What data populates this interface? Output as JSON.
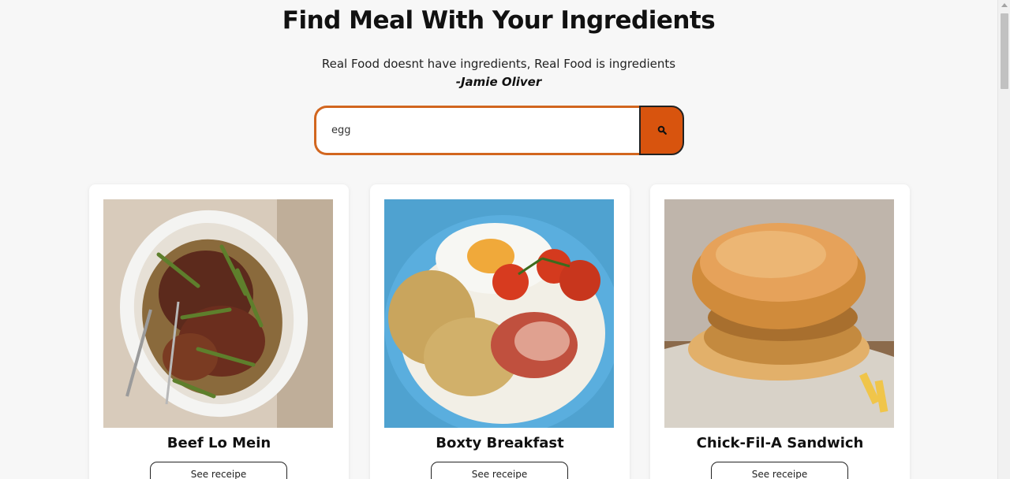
{
  "header": {
    "title": "Find Meal With Your Ingredients",
    "quote": "Real Food doesnt have ingredients, Real Food is ingredients",
    "author": "-Jamie Oliver"
  },
  "search": {
    "value": "egg",
    "button_icon": "search-icon"
  },
  "meals": [
    {
      "name": "Beef Lo Mein",
      "button_label": "See receipe"
    },
    {
      "name": "Boxty Breakfast",
      "button_label": "See receipe"
    },
    {
      "name": "Chick-Fil-A Sandwich",
      "button_label": "See receipe"
    }
  ],
  "colors": {
    "accent": "#d8540e",
    "input_border": "#d2661f",
    "background": "#f7f7f7"
  }
}
